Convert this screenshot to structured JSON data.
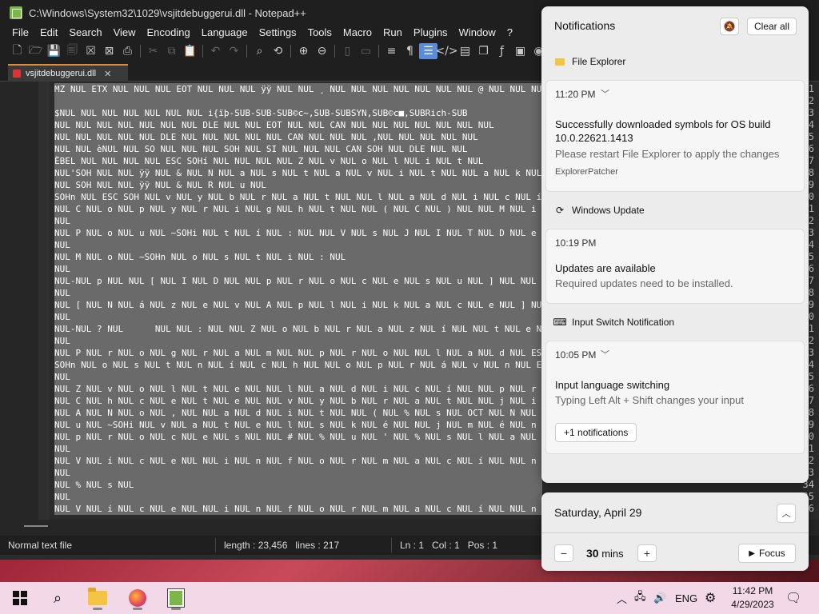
{
  "npp": {
    "title": "C:\\Windows\\System32\\1029\\vsjitdebuggerui.dll - Notepad++",
    "menu": [
      "File",
      "Edit",
      "Search",
      "View",
      "Encoding",
      "Language",
      "Settings",
      "Tools",
      "Macro",
      "Run",
      "Plugins",
      "Window",
      "?"
    ],
    "tab_label": "vsjitdebuggerui.dll",
    "tab_close": "✕",
    "line_numbers": [
      "1",
      "2",
      "3",
      "4",
      "5",
      "6",
      "7",
      "8",
      "9",
      "10",
      "11",
      "12",
      "13",
      "14",
      "15",
      "16",
      "17",
      "18",
      "19",
      "20",
      "21",
      "22",
      "23",
      "24",
      "25",
      "26",
      "27",
      "28",
      "29",
      "30",
      "31",
      "32",
      "33",
      "34",
      "35",
      "36"
    ],
    "lines": [
      "MZ NUL ETX NUL NUL NUL EOT NUL NUL NUL ÿÿ NUL NUL ¸ NUL NUL NUL NUL NUL NUL NUL @ NUL NUL NUL",
      "",
      "$NUL NUL NUL NUL NUL NUL NUL i{ïþ-SUB-SUB-SUB©c~,SUB-SUBSYN,SUB©c■,SUBRich-SUB",
      "NUL NUL NUL NUL NUL NUL NUL DLE NUL NUL EOT NUL NUL CAN NUL NUL NUL NUL NUL NUL NUL",
      "NUL NUL NUL NUL NUL DLE NUL NUL NUL NUL NUL CAN NUL NUL NUL ,NUL NUL NUL NUL NUL",
      "NUL NUL èNUL NUL SO NUL NUL NUL SOH NUL SI NUL NUL NUL CAN SOH NUL DLE NUL NUL",
      "ËBEL NUL NUL NUL NUL ESC SOHí NUL NUL NUL NUL Z NUL v NUL o NUL l NUL i NUL t NUL",
      "NUL'SOH NUL NUL ÿÿ NUL & NUL N NUL a NUL s NUL t NUL a NUL v NUL i NUL t NUL NUL a NUL k NUL t",
      "NUL SOH NUL NUL ÿÿ NUL & NUL R NUL u NUL",
      "SOHn NUL ESC SOH NUL v NUL y NUL b NUL r NUL a NUL t NUL NUL l NUL a NUL d NUL i NUL c NUL í NUL",
      "NUL C NUL o NUL p NUL y NUL r NUL i NUL g NUL h NUL t NUL NUL ( NUL C NUL ) NUL NUL M NUL i NUL c",
      "NUL",
      "NUL P NUL o NUL u NUL ~SOHi NUL t NUL í NUL : NUL NUL V NUL s NUL J NUL I NUL T NUL D NUL e NUL b",
      "NUL",
      "NUL M NUL o NUL ~SOHn NUL o NUL s NUL t NUL i NUL : NUL",
      "NUL",
      "NUL-NUL p NUL NUL [ NUL I NUL D NUL NUL p NUL r NUL o NUL c NUL e NUL s NUL u NUL ] NUL NUL",
      "NUL",
      "NUL [ NUL N NUL á NUL z NUL e NUL v NUL A NUL p NUL l NUL i NUL k NUL a NUL c NUL e NUL ] NUL NUL [",
      "NUL",
      "NUL-NUL ? NUL      NUL NUL : NUL NUL Z NUL o NUL b NUL r NUL a NUL z NUL í NUL NUL t NUL e NUL",
      "NUL",
      "NUL P NUL r NUL o NUL g NUL r NUL a NUL m NUL NUL p NUL r NUL o NUL NUL l NUL a NUL d NUL ESC SOH",
      "SOHn NUL o NUL s NUL t NUL n NUL í NUL c NUL h NUL NUL o NUL p NUL r NUL á NUL v NUL n NUL ESC SOH",
      "NUL",
      "NUL Z NUL v NUL o NUL l NUL t NUL e NUL NUL l NUL a NUL d NUL i NUL c NUL í NUL NUL p NUL r NUL o",
      "NUL C NUL h NUL c NUL e NUL t NUL e NUL NUL v NUL y NUL b NUL r NUL a NUL t NUL NUL j NUL i NUL n",
      "NUL A NUL N NUL o NUL , NUL NUL a NUL d NUL i NUL t NUL NUL ( NUL % NUL s NUL OCT NUL N NUL e NUL",
      "NUL u NUL ~SOHi NUL v NUL a NUL t NUL e NUL l NUL s NUL k NUL é NUL NUL j NUL m NUL é NUL n NUL o",
      "NUL p NUL r NUL o NUL c NUL e NUL s NUL NUL # NUL % NUL u NUL ' NUL % NUL s NUL l NUL a NUL d",
      "NUL",
      "NUL V NUL í NUL c NUL e NUL NUL i NUL n NUL f NUL o NUL r NUL m NUL a NUL c NUL í NUL NUL n NUL a",
      "NUL",
      "NUL % NUL s NUL",
      "NUL",
      "NUL V NUL í NUL c NUL e NUL NUL i NUL n NUL f NUL o NUL r NUL m NUL a NUL c NUL í NUL NUL n NUL a"
    ],
    "status": {
      "type": "Normal text file",
      "length": "length : 23,456",
      "lines": "lines : 217",
      "ln": "Ln : 1",
      "col": "Col : 1",
      "pos": "Pos : 1"
    }
  },
  "notifications": {
    "title": "Notifications",
    "clear_all": "Clear all",
    "groups": [
      {
        "app": "File Explorer",
        "time": "11:20 PM",
        "title": "Successfully downloaded symbols for OS build 10.0.22621.1413",
        "body": "Please restart File Explorer to apply the changes",
        "attribution": "ExplorerPatcher"
      },
      {
        "app": "Windows Update",
        "time": "10:19 PM",
        "title": "Updates are available",
        "body": "Required updates need to be installed."
      },
      {
        "app": "Input Switch Notification",
        "time": "10:05 PM",
        "title": "Input language switching",
        "body": "Typing Left Alt + Shift changes your input",
        "more": "+1 notifications"
      }
    ]
  },
  "calendar": {
    "date": "Saturday, April 29",
    "focus_value": "30",
    "focus_unit": "mins",
    "focus_label": "Focus"
  },
  "taskbar": {
    "language": "ENG",
    "time": "11:42 PM",
    "date": "4/29/2023"
  }
}
